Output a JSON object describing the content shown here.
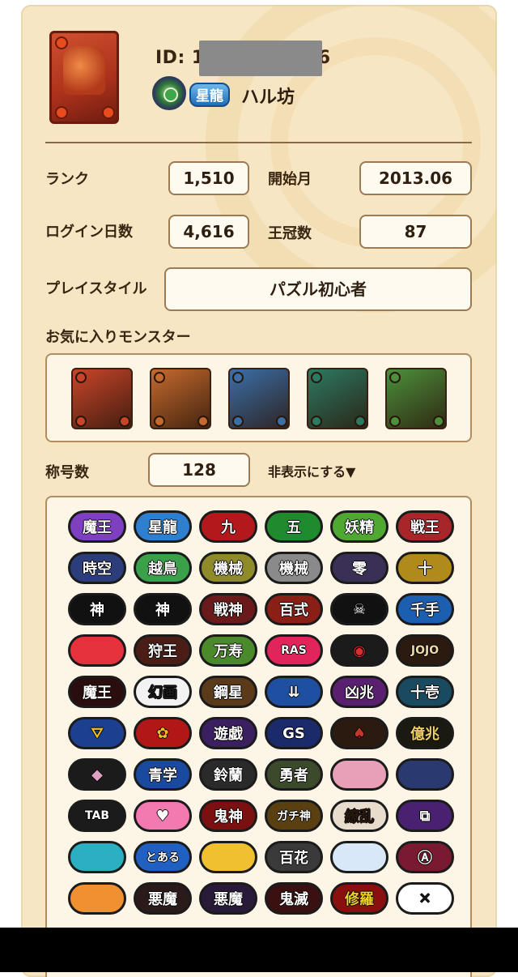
{
  "profile": {
    "id_label": "ID: 1",
    "id_suffix": "6",
    "title": "星龍",
    "name": "ハル坊"
  },
  "stats": {
    "rank_label": "ランク",
    "rank_value": "1,510",
    "start_label": "開始月",
    "start_value": "2013.06",
    "login_label": "ログイン日数",
    "login_value": "4,616",
    "crown_label": "王冠数",
    "crown_value": "87",
    "style_label": "プレイスタイル",
    "style_value": "パズル初心者"
  },
  "favorites": {
    "label": "お気に入りモンスター",
    "monsters": [
      {
        "name": "red-mech-monster",
        "color": "#c9452a"
      },
      {
        "name": "red-gold-mech-monster",
        "color": "#c56a2e"
      },
      {
        "name": "blue-fire-monster",
        "color": "#3b6fa8"
      },
      {
        "name": "green-blue-knight-monster",
        "color": "#2c7a62"
      },
      {
        "name": "green-mech-monster",
        "color": "#4c8f3c"
      }
    ]
  },
  "titles": {
    "count_label": "称号数",
    "count_value": "128",
    "toggle": "非表示にする▼",
    "rows": [
      [
        {
          "text": "魔王",
          "bg": "#7e3fc0",
          "fg": "#ffffff"
        },
        {
          "text": "星龍",
          "bg": "#2f7fd0",
          "fg": "#ffffff"
        },
        {
          "text": "九",
          "bg": "#b3181c",
          "fg": "#ffffff"
        },
        {
          "text": "五",
          "bg": "#1f8a2e",
          "fg": "#ffffff"
        },
        {
          "text": "妖精",
          "bg": "#4fa832",
          "fg": "#ffffff"
        },
        {
          "text": "戦王",
          "bg": "#a8262a",
          "fg": "#ffffff"
        }
      ],
      [
        {
          "text": "時空",
          "bg": "#2b3d7a",
          "fg": "#ffffff"
        },
        {
          "text": "越鳥",
          "bg": "#3aa04a",
          "fg": "#ffffff"
        },
        {
          "text": "機械",
          "bg": "#8f8a2a",
          "fg": "#ffffff"
        },
        {
          "text": "機械",
          "bg": "#8a8a8a",
          "fg": "#ffffff"
        },
        {
          "text": "零",
          "bg": "#3a2f55",
          "fg": "#ffffff"
        },
        {
          "text": "十",
          "bg": "#b08a1a",
          "fg": "#ffffff"
        }
      ],
      [
        {
          "text": "神",
          "bg": "#111111",
          "fg": "#ffffff"
        },
        {
          "text": "神",
          "bg": "#111111",
          "fg": "#ffffff"
        },
        {
          "text": "戦神",
          "bg": "#6a1a1a",
          "fg": "#ffffff"
        },
        {
          "text": "百式",
          "bg": "#8a1f15",
          "fg": "#ffffff"
        },
        {
          "text": "☠",
          "bg": "#111111",
          "fg": "#ffffff"
        },
        {
          "text": "千手",
          "bg": "#1c5fb0",
          "fg": "#ffffff"
        }
      ],
      [
        {
          "text": "",
          "bg": "#e5323c",
          "fg": "#ffffff"
        },
        {
          "text": "狩王",
          "bg": "#4a1e16",
          "fg": "#ffffff"
        },
        {
          "text": "万寿",
          "bg": "#4a8a2a",
          "fg": "#ffffff"
        },
        {
          "text": "RAS",
          "bg": "#e1245a",
          "fg": "#ffffff"
        },
        {
          "text": "◉",
          "bg": "#1b1b1b",
          "fg": "#d83030"
        },
        {
          "text": "JOJO",
          "bg": "#2a1a10",
          "fg": "#f0d9a8"
        }
      ],
      [
        {
          "text": "魔王",
          "bg": "#2a0d0d",
          "fg": "#ffffff"
        },
        {
          "text": "幻画",
          "bg": "#f2f2f2",
          "fg": "#1a1a1a"
        },
        {
          "text": "鋼星",
          "bg": "#5a3a18",
          "fg": "#ffffff"
        },
        {
          "text": "⇊",
          "bg": "#1f4fa0",
          "fg": "#ffffff"
        },
        {
          "text": "凶兆",
          "bg": "#5a2070",
          "fg": "#ffffff"
        },
        {
          "text": "十壱",
          "bg": "#1a4a60",
          "fg": "#ffffff"
        }
      ],
      [
        {
          "text": "⛛",
          "bg": "#1d3f8f",
          "fg": "#f0c020"
        },
        {
          "text": "✿",
          "bg": "#b01818",
          "fg": "#f0c020"
        },
        {
          "text": "遊戯",
          "bg": "#3a2060",
          "fg": "#ffffff"
        },
        {
          "text": "GS",
          "bg": "#1a2a6a",
          "fg": "#ffffff"
        },
        {
          "text": "♠",
          "bg": "#2a1a10",
          "fg": "#c0392b"
        },
        {
          "text": "億兆",
          "bg": "#1a1a10",
          "fg": "#f0d060"
        }
      ],
      [
        {
          "text": "◆",
          "bg": "#1b1b1b",
          "fg": "#e0a0c0"
        },
        {
          "text": "青学",
          "bg": "#1a4aa0",
          "fg": "#ffffff"
        },
        {
          "text": "鈴蘭",
          "bg": "#2a2a2a",
          "fg": "#ffffff"
        },
        {
          "text": "勇者",
          "bg": "#3a4a2a",
          "fg": "#ffffff"
        },
        {
          "text": "",
          "bg": "#e8a0b8",
          "fg": "#ffffff"
        },
        {
          "text": "",
          "bg": "#2a3a70",
          "fg": "#ffffff"
        }
      ],
      [
        {
          "text": "TAB",
          "bg": "#1b1b1b",
          "fg": "#ffffff"
        },
        {
          "text": "♥",
          "bg": "#f27ab0",
          "fg": "#ffffff"
        },
        {
          "text": "鬼神",
          "bg": "#7a1010",
          "fg": "#ffffff"
        },
        {
          "text": "ガチ神",
          "bg": "#5a4010",
          "fg": "#ffffff"
        },
        {
          "text": "繚乱",
          "bg": "#e8dccc",
          "fg": "#2a1a10"
        },
        {
          "text": "⧉",
          "bg": "#4a2070",
          "fg": "#ffffff"
        }
      ],
      [
        {
          "text": "",
          "bg": "#2ab0c0",
          "fg": "#ffffff"
        },
        {
          "text": "とある",
          "bg": "#2060c0",
          "fg": "#ffffff"
        },
        {
          "text": "",
          "bg": "#f0c030",
          "fg": "#ffffff"
        },
        {
          "text": "百花",
          "bg": "#3a3a3a",
          "fg": "#ffffff"
        },
        {
          "text": "",
          "bg": "#d8e8f8",
          "fg": "#ffffff"
        },
        {
          "text": "Ⓐ",
          "bg": "#7a1a30",
          "fg": "#ffffff"
        }
      ],
      [
        {
          "text": "",
          "bg": "#f09030",
          "fg": "#ffffff"
        },
        {
          "text": "悪魔",
          "bg": "#2a1a1a",
          "fg": "#ffffff"
        },
        {
          "text": "悪魔",
          "bg": "#2a1a3a",
          "fg": "#ffffff"
        },
        {
          "text": "鬼滅",
          "bg": "#3a1010",
          "fg": "#ffffff"
        },
        {
          "text": "修羅",
          "bg": "#8a1010",
          "fg": "#f0d020"
        },
        {
          "text": "✕",
          "bg": "#ffffff",
          "fg": "#1a1a1a"
        }
      ]
    ]
  }
}
